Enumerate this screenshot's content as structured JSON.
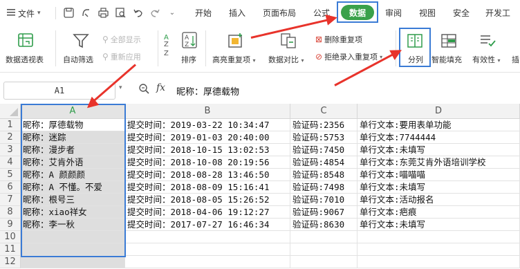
{
  "menu": {
    "file_label": "文件",
    "tabs": [
      "开始",
      "插入",
      "页面布局",
      "公式",
      "数据",
      "审阅",
      "视图",
      "安全",
      "开发工"
    ],
    "active_tab": "数据"
  },
  "ribbon": {
    "pivot": "数据透视表",
    "autofilter": "自动筛选",
    "show_all": "全部显示",
    "reapply": "重新应用",
    "sort": "排序",
    "highlight_dup": "高亮重复项",
    "compare": "数据对比",
    "remove_dup": "删除重复项",
    "reject_dup": "拒绝录入重复项",
    "split": "分列",
    "flash_fill": "智能填充",
    "validity": "有效性",
    "insert": "插"
  },
  "formula_bar": {
    "name_box": "A1",
    "fx": "fx",
    "content": "昵称：厚德载物"
  },
  "grid": {
    "columns": [
      "A",
      "B",
      "C",
      "D"
    ],
    "row_numbers": [
      "1",
      "2",
      "3",
      "4",
      "5",
      "6",
      "7",
      "8",
      "9",
      "10",
      "11",
      "12"
    ],
    "rows": [
      {
        "a": "昵称：厚德载物",
        "b": "提交时间：2019-03-22 10:34:47",
        "c": "验证码:2356",
        "d": "单行文本:要用表单功能"
      },
      {
        "a": "昵称：迷踪",
        "b": "提交时间：2019-01-03 20:40:00",
        "c": "验证码:5753",
        "d": "单行文本:7744444"
      },
      {
        "a": "昵称：漫步者",
        "b": "提交时间：2018-10-15 13:02:53",
        "c": "验证码:7450",
        "d": "单行文本:未填写"
      },
      {
        "a": "昵称：艾肯外语",
        "b": "提交时间：2018-10-08 20:19:56",
        "c": "验证码:4854",
        "d": "单行文本:东莞艾肯外语培训学校"
      },
      {
        "a": "昵称：A  颜颜颜",
        "b": "提交时间：2018-08-28 13:46:50",
        "c": "验证码:8548",
        "d": "单行文本:喵喵喵"
      },
      {
        "a": "昵称：A 不懂。不爱",
        "b": "提交时间：2018-08-09 15:16:41",
        "c": "验证码:7498",
        "d": "单行文本:未填写"
      },
      {
        "a": "昵称：根号三",
        "b": "提交时间：2018-08-05 15:26:52",
        "c": "验证码:7010",
        "d": "单行文本:活动报名"
      },
      {
        "a": "昵称：xiao祥女",
        "b": "提交时间：2018-04-06 19:12:27",
        "c": "验证码:9067",
        "d": "单行文本:疤痕"
      },
      {
        "a": "昵称：李一秋",
        "b": "提交时间：2017-07-27 16:46:34",
        "c": "验证码:8630",
        "d": "单行文本:未填写"
      },
      {
        "a": "",
        "b": "",
        "c": "",
        "d": ""
      },
      {
        "a": "",
        "b": "",
        "c": "",
        "d": ""
      },
      {
        "a": "",
        "b": "",
        "c": "",
        "d": ""
      }
    ]
  },
  "colors": {
    "active_tab": "#3aa14a",
    "highlight_box": "#3a7bd5",
    "annotation_arrow": "#e8332b",
    "selected_column": "#dedede"
  }
}
